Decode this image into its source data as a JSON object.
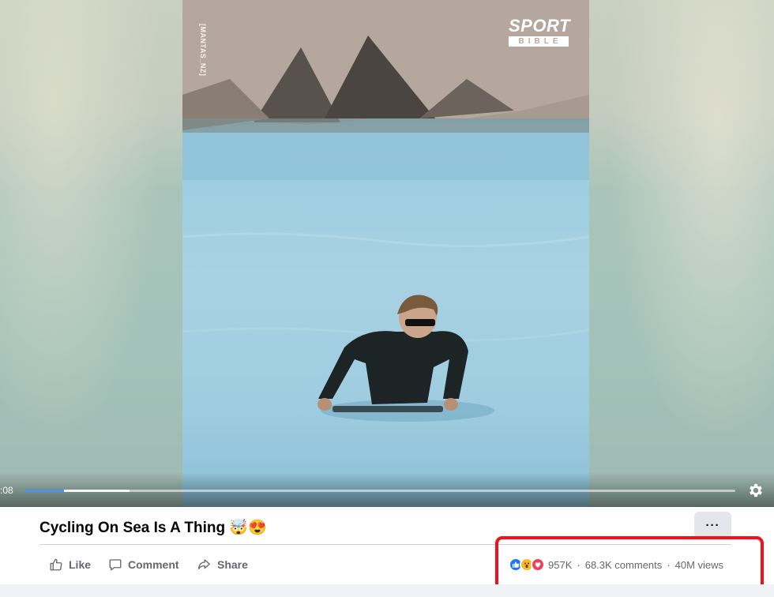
{
  "video": {
    "watermark": "[MANTAS_NZ]",
    "logo_top": "SPORT",
    "logo_bottom": "BIBLE",
    "time": ":08",
    "progress_played": 0.056,
    "progress_buffered": 0.148
  },
  "post": {
    "title": "Cycling On Sea Is A Thing 🤯😍",
    "more_label": "···"
  },
  "actions": {
    "like": "Like",
    "comment": "Comment",
    "share": "Share"
  },
  "stats": {
    "reactions_count": "957K",
    "comments": "68.3K comments",
    "views": "40M views",
    "separator": "·"
  },
  "colors": {
    "accent": "#1877f2",
    "progress": "#4f8ff0",
    "highlight": "#f2101d"
  },
  "icons": [
    "like-icon",
    "comment-icon",
    "share-icon",
    "settings-gear-icon",
    "like-reaction-icon",
    "wow-reaction-icon",
    "love-reaction-icon"
  ]
}
